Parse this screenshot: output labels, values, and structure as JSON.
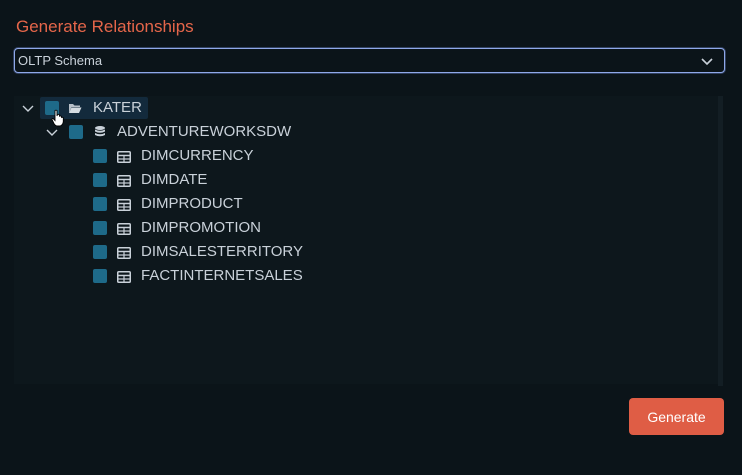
{
  "dialog": {
    "title": "Generate Relationships",
    "generate_label": "Generate"
  },
  "schema_select": {
    "value": "OLTP Schema",
    "icon": "chevron-down-icon"
  },
  "tree": {
    "server": {
      "label": "KATER",
      "icon": "folder-open-icon",
      "checked": "partial",
      "expanded": true
    },
    "database": {
      "label": "ADVENTUREWORKSDW",
      "icon": "database-icon",
      "checked": "partial",
      "expanded": true
    },
    "tables": [
      {
        "label": "DIMCURRENCY",
        "icon": "table-icon"
      },
      {
        "label": "DIMDATE",
        "icon": "table-icon"
      },
      {
        "label": "DIMPRODUCT",
        "icon": "table-icon"
      },
      {
        "label": "DIMPROMOTION",
        "icon": "table-icon"
      },
      {
        "label": "DIMSALESTERRITORY",
        "icon": "table-icon"
      },
      {
        "label": "FACTINTERNETSALES",
        "icon": "table-icon"
      }
    ]
  },
  "colors": {
    "accent": "#df5d45",
    "checkbox": "#1e6a89",
    "background": "#0b1419",
    "focus_border": "#8fa8e8"
  }
}
